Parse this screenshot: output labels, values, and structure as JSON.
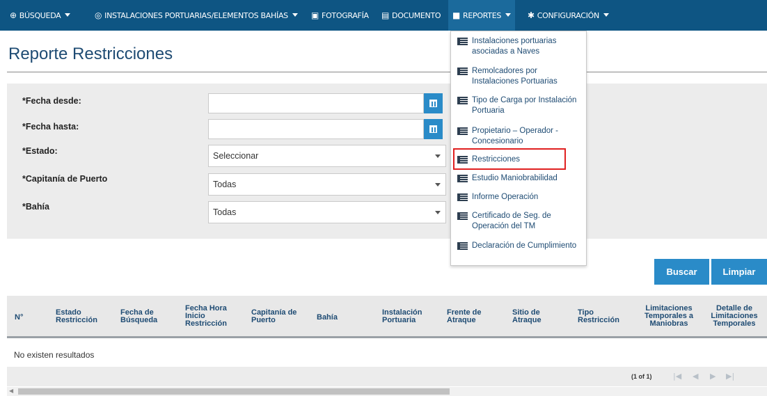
{
  "nav": {
    "busqueda": "BÚSQUEDA",
    "instalaciones": "INSTALACIONES PORTUARIAS/ELEMENTOS BAHÍAS",
    "fotografia": "FOTOGRAFÍA",
    "documento": "DOCUMENTO",
    "reportes": "REPORTES",
    "configuracion": "CONFIGURACIÓN"
  },
  "page": {
    "title": "Reporte Restricciones"
  },
  "form": {
    "fecha_desde_label": "*Fecha desde:",
    "fecha_hasta_label": "*Fecha hasta:",
    "estado_label": "*Estado:",
    "estado_value": "Seleccionar",
    "capitania_label": "*Capitanía de Puerto",
    "capitania_value": "Todas",
    "bahia_label": "*Bahía",
    "bahia_value": "Todas"
  },
  "buttons": {
    "buscar": "Buscar",
    "limpiar": "Limpiar"
  },
  "table": {
    "columns": [
      "N°",
      "Estado Restricción",
      "Fecha de Búsqueda",
      "Fecha Hora Inicio Restricción",
      "Capitanía de Puerto",
      "Bahía",
      "Instalación Portuaria",
      "Frente de Atraque",
      "Sitio de Atraque",
      "Tipo Restricción",
      "Limitaciones Temporales a Maniobras",
      "Detalle de Limitaciones Temporales"
    ],
    "empty_message": "No existen resultados",
    "pager": "(1 of 1)"
  },
  "reportes_menu": {
    "items": [
      "Instalaciones portuarias asociadas a Naves",
      "Remolcadores por Instalaciones Portuarias",
      "Tipo de Carga por Instalación Portuaria",
      "Propietario – Operador - Concesionario",
      "Restricciones",
      "Estudio Maniobrabilidad",
      "Informe Operación",
      "Certificado de Seg. de Operación del TM",
      "Declaración de Cumplimiento"
    ],
    "selected": "Restricciones"
  },
  "colors": {
    "nav_bg": "#0e5583",
    "accent": "#2a8bc8",
    "title": "#1e4b73",
    "highlight": "#e02020"
  }
}
